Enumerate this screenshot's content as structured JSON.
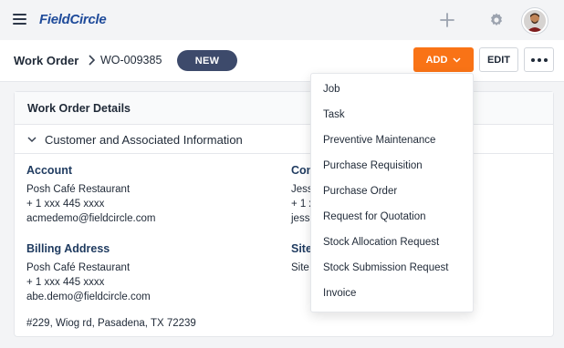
{
  "app": {
    "logo": "FieldCircle"
  },
  "breadcrumb": {
    "root": "Work Order",
    "current": "WO-009385"
  },
  "status": {
    "label": "NEW"
  },
  "toolbar": {
    "add_label": "ADD",
    "edit_label": "EDIT"
  },
  "card": {
    "title": "Work Order Details",
    "section_title": "Customer and Associated Information",
    "account": {
      "label": "Account",
      "lines": [
        "Posh Café Restaurant",
        "+ 1 xxx 445 xxxx",
        "acmedemo@fieldcircle.com"
      ]
    },
    "contact": {
      "label": "Con",
      "lines": [
        "Jess",
        "+ 1 xxx",
        "jess"
      ]
    },
    "billing": {
      "label": "Billing Address",
      "lines": [
        "Posh Café Restaurant",
        "+ 1 xxx 445 xxxx",
        "abe.demo@fieldcircle.com"
      ],
      "address": "#229, Wiog rd, Pasadena, TX 72239"
    },
    "site": {
      "label": "Site",
      "lines": [
        "Site"
      ]
    }
  },
  "dropdown": {
    "items": [
      "Job",
      "Task",
      "Preventive Maintenance",
      "Purchase Requisition",
      "Purchase Order",
      "Request for Quotation",
      "Stock Allocation Request",
      "Stock Submission Request",
      "Invoice"
    ]
  },
  "colors": {
    "accent": "#f97316",
    "badge": "#3d4a6b",
    "brand": "#1f4b9a"
  },
  "icons": [
    "hamburger-icon",
    "plus-icon",
    "gear-icon",
    "chevron-right-icon",
    "chevron-down-icon",
    "more-icon"
  ]
}
